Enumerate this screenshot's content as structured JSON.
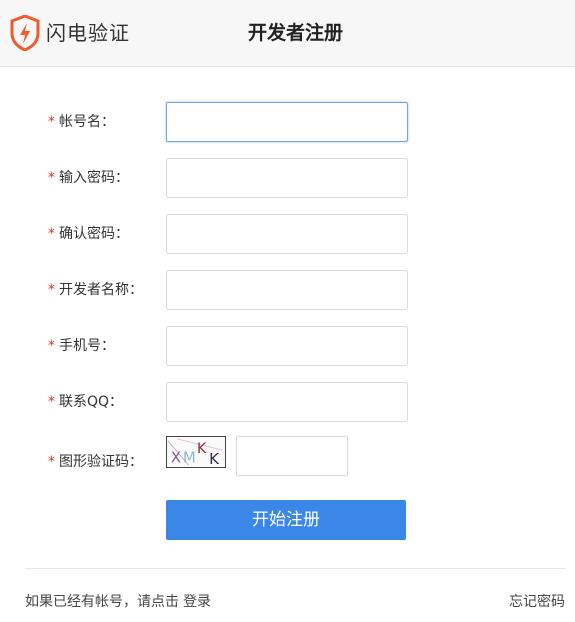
{
  "header": {
    "brand": "闪电验证",
    "title": "开发者注册"
  },
  "form": {
    "required_mark": "*",
    "fields": [
      {
        "label": "帐号名：",
        "value": "",
        "focused": true
      },
      {
        "label": "输入密码：",
        "value": ""
      },
      {
        "label": "确认密码：",
        "value": ""
      },
      {
        "label": "开发者名称：",
        "value": ""
      },
      {
        "label": "手机号：",
        "value": ""
      },
      {
        "label": "联系QQ：",
        "value": ""
      }
    ],
    "captcha": {
      "label": "图形验证码：",
      "image_text": "XMKK",
      "value": ""
    },
    "submit_label": "开始注册"
  },
  "footer": {
    "prompt": "如果已经有帐号，请点击",
    "login_link": "登录",
    "forgot_link": "忘记密码"
  },
  "colors": {
    "accent": "#3b87e8",
    "required": "#e0372f",
    "logo": "#ef5b2f"
  }
}
